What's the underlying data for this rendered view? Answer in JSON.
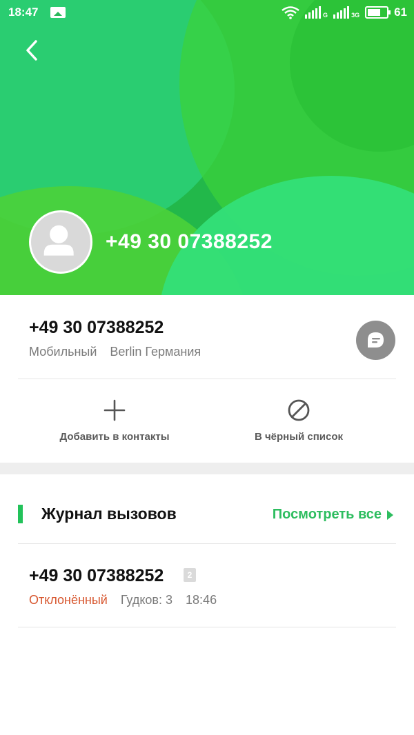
{
  "status_bar": {
    "time": "18:47",
    "battery_level": "61",
    "network1_tag": "G",
    "network2_tag": "3G"
  },
  "header": {
    "phone_number": "+49 30 07388252"
  },
  "info": {
    "phone_number": "+49 30 07388252",
    "type": "Мобильный",
    "location": "Berlin Германия"
  },
  "actions": {
    "add_contact_label": "Добавить в контакты",
    "blacklist_label": "В чёрный список"
  },
  "call_log": {
    "title": "Журнал вызовов",
    "view_all_label": "Посмотреть все",
    "entries": [
      {
        "number": "+49 30 07388252",
        "sim": "2",
        "status": "Отклонённый",
        "rings": "Гудков: 3",
        "time": "18:46"
      }
    ]
  },
  "colors": {
    "accent_green": "#2dbd5f",
    "rejected_red": "#d7562e",
    "header_green": "#22b84a"
  },
  "icons": [
    "back-arrow-icon",
    "avatar-person-icon",
    "message-bubble-icon",
    "plus-icon",
    "block-icon",
    "wifi-icon",
    "signal-icon",
    "battery-icon",
    "image-icon"
  ]
}
